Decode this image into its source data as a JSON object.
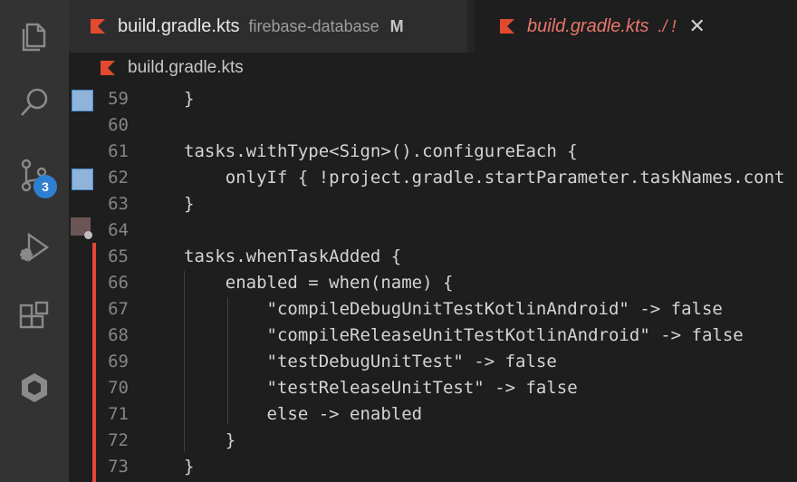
{
  "tabs": [
    {
      "name": "build.gradle.kts",
      "description": "firebase-database",
      "status": "M"
    },
    {
      "name": "build.gradle.kts",
      "description": "./ !",
      "close": "✕"
    }
  ],
  "breadcrumb": {
    "file": "build.gradle.kts"
  },
  "activity_bar": {
    "items": [
      "explorer-icon",
      "search-icon",
      "source-control-icon",
      "run-debug-icon",
      "extensions-icon",
      "remote-icon"
    ],
    "scm_badge": "3"
  },
  "editor": {
    "lines": [
      {
        "n": "59",
        "code": "}"
      },
      {
        "n": "60",
        "code": ""
      },
      {
        "n": "61",
        "code": "tasks.withType<Sign>().configureEach {"
      },
      {
        "n": "62",
        "code": "    onlyIf { !project.gradle.startParameter.taskNames.cont"
      },
      {
        "n": "63",
        "code": "}"
      },
      {
        "n": "64",
        "code": ""
      },
      {
        "n": "65",
        "code": "tasks.whenTaskAdded {"
      },
      {
        "n": "66",
        "code": "    enabled = when(name) {"
      },
      {
        "n": "67",
        "code": "        \"compileDebugUnitTestKotlinAndroid\" -> false"
      },
      {
        "n": "68",
        "code": "        \"compileReleaseUnitTestKotlinAndroid\" -> false"
      },
      {
        "n": "69",
        "code": "        \"testDebugUnitTest\" -> false"
      },
      {
        "n": "70",
        "code": "        \"testReleaseUnitTest\" -> false"
      },
      {
        "n": "71",
        "code": "        else -> enabled"
      },
      {
        "n": "72",
        "code": "    }"
      },
      {
        "n": "73",
        "code": "}"
      }
    ]
  },
  "colors": {
    "accent_badge": "#2f7fd0",
    "kotlin_logo": "#e24a2f",
    "deleted_tab": "#e8766a",
    "change_bar": "#e2473a"
  }
}
